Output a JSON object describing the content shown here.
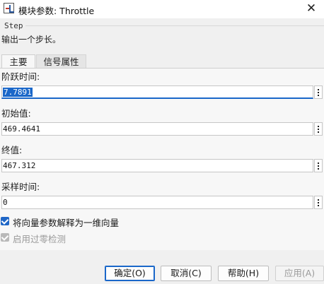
{
  "window": {
    "title": "模块参数: Throttle",
    "close_label": "✕"
  },
  "block": {
    "name": "Step",
    "description": "输出一个步长。"
  },
  "tabs": [
    {
      "label": "主要",
      "active": true
    },
    {
      "label": "信号属性",
      "active": false
    }
  ],
  "params": [
    {
      "label": "阶跃时间:",
      "value": "7.7891",
      "focused": true
    },
    {
      "label": "初始值:",
      "value": "469.4641",
      "focused": false
    },
    {
      "label": "终值:",
      "value": "467.312",
      "focused": false
    },
    {
      "label": "采样时间:",
      "value": "0",
      "focused": false
    }
  ],
  "options": [
    {
      "label": "将向量参数解释为一维向量",
      "checked": true,
      "enabled": true
    },
    {
      "label": "启用过零检测",
      "checked": true,
      "enabled": false
    }
  ],
  "buttons": {
    "ok": "确定(O)",
    "cancel": "取消(C)",
    "help": "帮助(H)",
    "apply": "应用(A)"
  },
  "colors": {
    "accent": "#1a67c9",
    "checkbox_checked": "#1f66c6",
    "checkbox_disabled": "#b9b9b9"
  },
  "icons": {
    "app": "simulink-block-icon",
    "close": "close-icon",
    "options": "vertical-ellipsis-icon"
  }
}
